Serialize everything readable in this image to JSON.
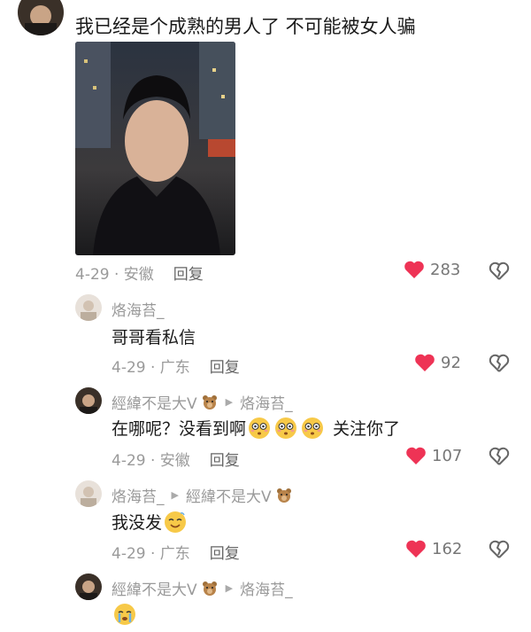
{
  "main_comment": {
    "text": "我已经是个成熟的男人了 不可能被女人骗",
    "date_loc": "4-29 · 安徽",
    "reply_label": "回复",
    "likes": "283"
  },
  "replies": [
    {
      "username": "烙海苔_",
      "reply_to": "",
      "text": "哥哥看私信",
      "date_loc": "4-29 · 广东",
      "reply_label": "回复",
      "likes": "92"
    },
    {
      "username": "經緯不是大V",
      "reply_to": "烙海苔_",
      "text": "在哪呢？没看到啊",
      "text_tail": "关注你了",
      "date_loc": "4-29 · 安徽",
      "reply_label": "回复",
      "likes": "107"
    },
    {
      "username": "烙海苔_",
      "reply_to": "經緯不是大V",
      "text": "我没发",
      "date_loc": "4-29 · 广东",
      "reply_label": "回复",
      "likes": "162"
    },
    {
      "username": "經緯不是大V",
      "reply_to": "烙海苔_"
    }
  ],
  "colors": {
    "heart": "#ee3355",
    "meta_gray": "#9a9a9a"
  },
  "icons": {
    "like": "heart-icon",
    "dislike": "broken-heart-icon",
    "emoji_stunned": "flushed-face-icon",
    "emoji_smile": "smiling-face-icon",
    "emoji_cry": "crying-face-icon"
  }
}
